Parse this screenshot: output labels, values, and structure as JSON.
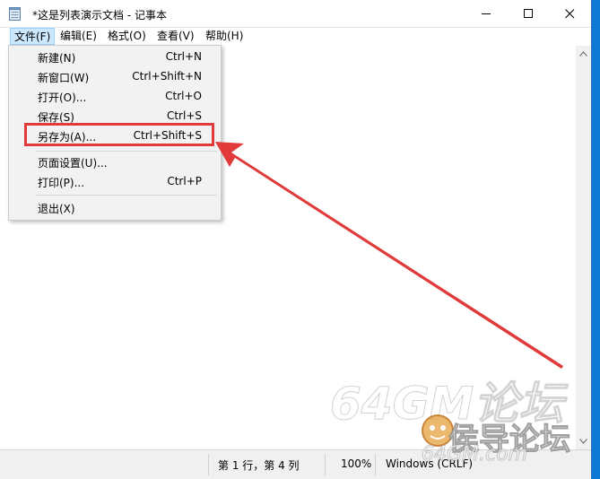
{
  "window": {
    "title": "*这是列表演示文档 - 记事本",
    "icon": "notepad-icon"
  },
  "menubar": {
    "items": [
      {
        "label": "文件(F)",
        "active": true
      },
      {
        "label": "编辑(E)"
      },
      {
        "label": "格式(O)"
      },
      {
        "label": "查看(V)"
      },
      {
        "label": "帮助(H)"
      }
    ]
  },
  "file_menu": {
    "items": [
      {
        "label": "新建(N)",
        "shortcut": "Ctrl+N"
      },
      {
        "label": "新窗口(W)",
        "shortcut": "Ctrl+Shift+N"
      },
      {
        "label": "打开(O)...",
        "shortcut": "Ctrl+O"
      },
      {
        "label": "保存(S)",
        "shortcut": "Ctrl+S"
      },
      {
        "label": "另存为(A)...",
        "shortcut": "Ctrl+Shift+S",
        "highlighted": true
      },
      {
        "label": "页面设置(U)...",
        "shortcut": ""
      },
      {
        "label": "打印(P)...",
        "shortcut": "Ctrl+P"
      },
      {
        "label": "退出(X)",
        "shortcut": ""
      }
    ]
  },
  "statusbar": {
    "position": "第 1 行，第 4 列",
    "zoom": "100%",
    "line_ending": "Windows (CRLF)"
  },
  "watermark": {
    "line1": "64GM论坛",
    "line2": "侯导论坛",
    "url": "64GM.com"
  },
  "colors": {
    "desktop": "#0f7ad6",
    "highlight_box": "#e03a3a",
    "arrow": "#e03a3a",
    "menu_active": "#cce8ff"
  }
}
